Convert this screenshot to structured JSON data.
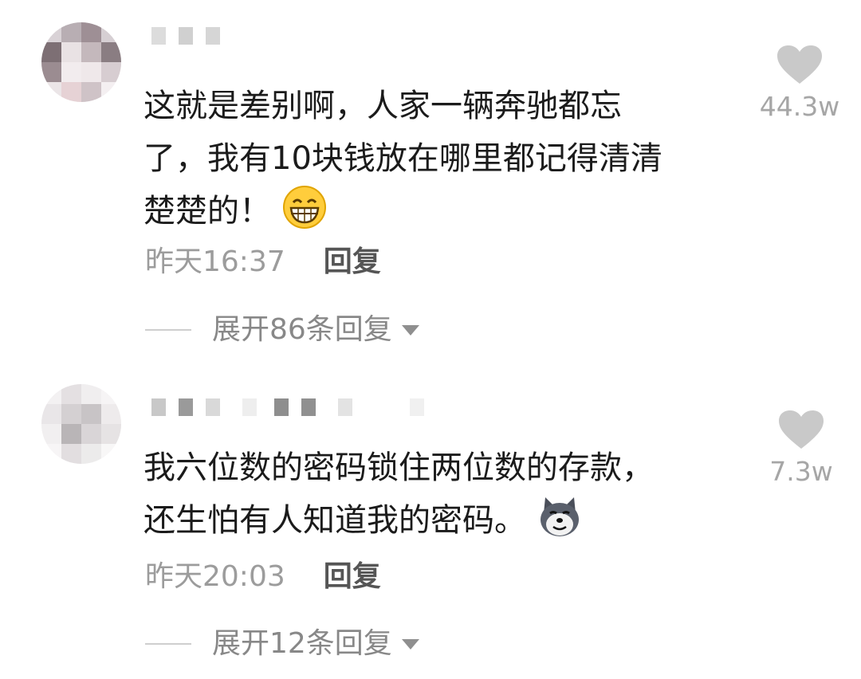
{
  "comments": [
    {
      "text_lines": [
        "这就是差别啊，人家一辆奔驰都忘",
        "了，我有10块钱放在哪里都记得清清",
        "楚楚的！"
      ],
      "emoji": "grinning-face-emoji",
      "time": "昨天16:37",
      "reply_label": "回复",
      "expand_label": "展开86条回复",
      "likes": "44.3w"
    },
    {
      "text_lines": [
        "我六位数的密码锁住两位数的存款，",
        "还生怕有人知道我的密码。"
      ],
      "emoji": "doge-wolf-emoji",
      "time": "昨天20:03",
      "reply_label": "回复",
      "expand_label": "展开12条回复",
      "likes": "7.3w"
    }
  ],
  "icons": {
    "like": "heart-icon",
    "expand": "caret-down-icon"
  },
  "colors": {
    "text": "#1b1b1b",
    "meta": "#9c9c9c",
    "reply": "#555555",
    "heart": "#c9c9c9"
  }
}
